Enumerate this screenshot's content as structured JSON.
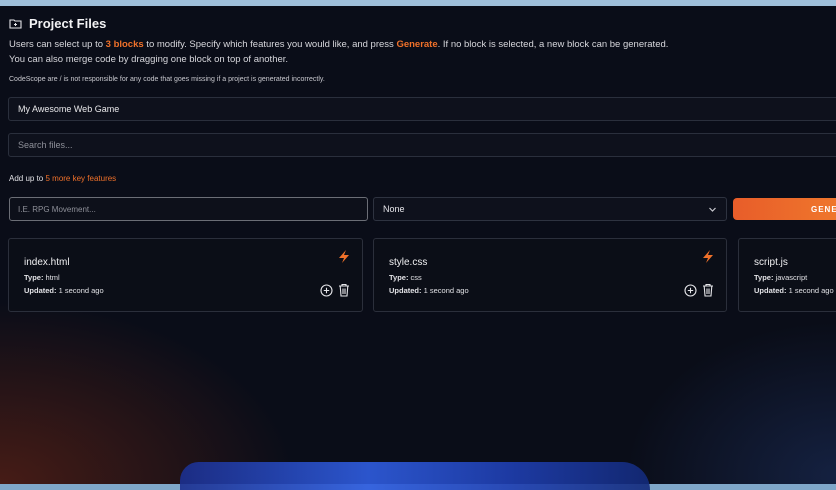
{
  "header": {
    "title": "Project Files",
    "icon": "folder-icon"
  },
  "description": {
    "line1_a": "Users can select up to ",
    "line1_blocks": "3 blocks",
    "line1_b": " to modify. Specify which features you would like, and press ",
    "line1_generate": "Generate",
    "line1_c": ". If no block is selected, a new block can be generated.",
    "line2": "You can also merge code by dragging one block on top of another.",
    "note": "CodeScope are / is not responsible for any code that goes missing if a project is generated incorrectly."
  },
  "project_name": {
    "value": "My Awesome Web Game"
  },
  "search": {
    "placeholder": "Search files..."
  },
  "features": {
    "prefix": "Add up to ",
    "count_text": "5 more key features",
    "input_placeholder": "I.E. RPG Movement...",
    "select_value": "None",
    "generate_label": "GENE"
  },
  "colors": {
    "accent": "#f0712a",
    "background": "#0a0d18",
    "border": "#2b2f3b"
  },
  "files": [
    {
      "name": "index.html",
      "type_label": "Type:",
      "type": "html",
      "updated_label": "Updated:",
      "updated": "1 second ago"
    },
    {
      "name": "style.css",
      "type_label": "Type:",
      "type": "css",
      "updated_label": "Updated:",
      "updated": "1 second ago"
    },
    {
      "name": "script.js",
      "type_label": "Type:",
      "type": "javascript",
      "updated_label": "Updated:",
      "updated": "1 second ago"
    }
  ]
}
